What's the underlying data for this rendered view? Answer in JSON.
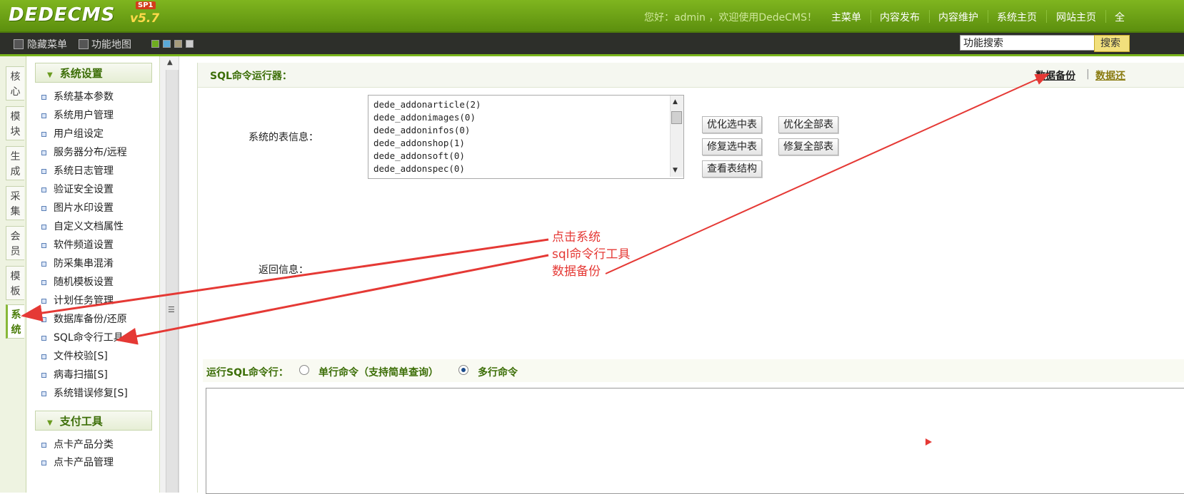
{
  "header": {
    "logo_text": "DEDECMS",
    "logo_version": "v5.7",
    "logo_badge": "SP1",
    "greeting": "您好：admin ，欢迎使用DedeCMS！",
    "nav": [
      "主菜单",
      "内容发布",
      "内容维护",
      "系统主页",
      "网站主页",
      "全"
    ]
  },
  "toolbar": {
    "hide_menu": "隐藏菜单",
    "function_map": "功能地图",
    "search_placeholder": "功能搜索",
    "search_button": "搜索",
    "swatch_colors": [
      "#6fae1f",
      "#5aa9d8",
      "#a79c7b",
      "#cccccc"
    ]
  },
  "vtabs": [
    "核心",
    "模块",
    "生成",
    "采集",
    "会员",
    "模板",
    "系统"
  ],
  "menu": {
    "section1_title": "系统设置",
    "section1_items": [
      "系统基本参数",
      "系统用户管理",
      "用户组设定",
      "服务器分布/远程",
      "系统日志管理",
      "验证安全设置",
      "图片水印设置",
      "自定义文档属性",
      "软件频道设置",
      "防采集串混淆",
      "随机模板设置",
      "计划任务管理",
      "数据库备份/还原",
      "SQL命令行工具",
      "文件校验[S]",
      "病毒扫描[S]",
      "系统错误修复[S]"
    ],
    "section2_title": "支付工具",
    "section2_items": [
      "点卡产品分类",
      "点卡产品管理"
    ]
  },
  "panel": {
    "title": "SQL命令运行器：",
    "link_backup": "数据备份",
    "link_separator": "|",
    "link_restore": "数据还",
    "tables_label": "系统的表信息：",
    "tables": [
      "dede_addonarticle(2)",
      "dede_addonimages(0)",
      "dede_addoninfos(0)",
      "dede_addonshop(1)",
      "dede_addonsoft(0)",
      "dede_addonspec(0)"
    ],
    "btn_optimize_selected": "优化选中表",
    "btn_optimize_all": "优化全部表",
    "btn_repair_selected": "修复选中表",
    "btn_repair_all": "修复全部表",
    "btn_view_structure": "查看表结构",
    "return_label": "返回信息：",
    "run_label": "运行SQL命令行：",
    "radio_single": "单行命令（支持简单查询）",
    "radio_multi": "多行命令",
    "radio_selected": "multi"
  },
  "annotation": {
    "lines": [
      "点击系统",
      "sql命令行工具",
      "数据备份"
    ],
    "color": "#e53935"
  }
}
